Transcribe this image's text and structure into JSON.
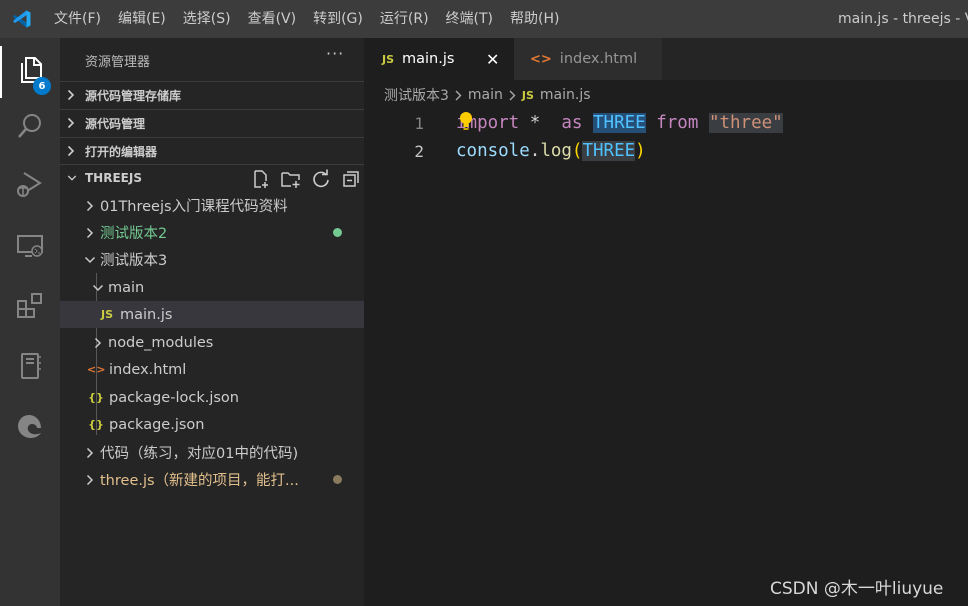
{
  "titlebar": {
    "menus": [
      "文件(F)",
      "编辑(E)",
      "选择(S)",
      "查看(V)",
      "转到(G)",
      "运行(R)",
      "终端(T)",
      "帮助(H)"
    ],
    "window_title": "main.js - threejs - Vi"
  },
  "activity": {
    "explorer_badge": "6",
    "items": [
      "files-icon",
      "search-icon",
      "run-debug-icon",
      "remote-explorer-icon",
      "extensions-icon",
      "notebook-icon",
      "edge-icon"
    ]
  },
  "sidebar": {
    "title": "资源管理器",
    "more": "···",
    "sections": {
      "scm_repos": "源代码管理存储库",
      "scm": "源代码管理",
      "open_editors": "打开的编辑器",
      "workspace": "THREEJS"
    },
    "tree": {
      "item0": "01Threejs入门课程代码资料",
      "item1": "测试版本2",
      "item2": "测试版本3",
      "item3": "main",
      "item4": "main.js",
      "item5": "node_modules",
      "item6": "index.html",
      "item7": "package-lock.json",
      "item8": "package.json",
      "item9": "代码（练习，对应01中的代码)",
      "item10": "three.js（新建的项目，能打..."
    },
    "icons": {
      "js": "JS",
      "html": "<>",
      "json": "{}"
    },
    "colors": {
      "modified_green": "#73c991",
      "modified_brown": "#e2c08d"
    }
  },
  "editor": {
    "tabs": [
      {
        "icon": "JS",
        "label": "main.js",
        "close": "✕"
      },
      {
        "icon": "<>",
        "label": "index.html"
      }
    ],
    "breadcrumb": {
      "seg1": "测试版本3",
      "seg2": "main",
      "icon": "JS",
      "seg3": "main.js"
    },
    "lines": {
      "n1": "1",
      "n2": "2",
      "l1_import": "import",
      "l1_star": " *  ",
      "l1_as": "as",
      "l1_space": " ",
      "l1_three": "THREE",
      "l1_from": "from",
      "l1_str": "\"three\"",
      "l2_console": "console",
      "l2_dot": ".",
      "l2_log": "log",
      "l2_open": "(",
      "l2_three": "THREE",
      "l2_close": ")"
    }
  },
  "watermark": "CSDN @木一叶liuyue",
  "colors": {
    "accent": "#007acc",
    "activity_bg": "#333333",
    "sidebar_bg": "#252526",
    "editor_bg": "#1e1e1e"
  }
}
